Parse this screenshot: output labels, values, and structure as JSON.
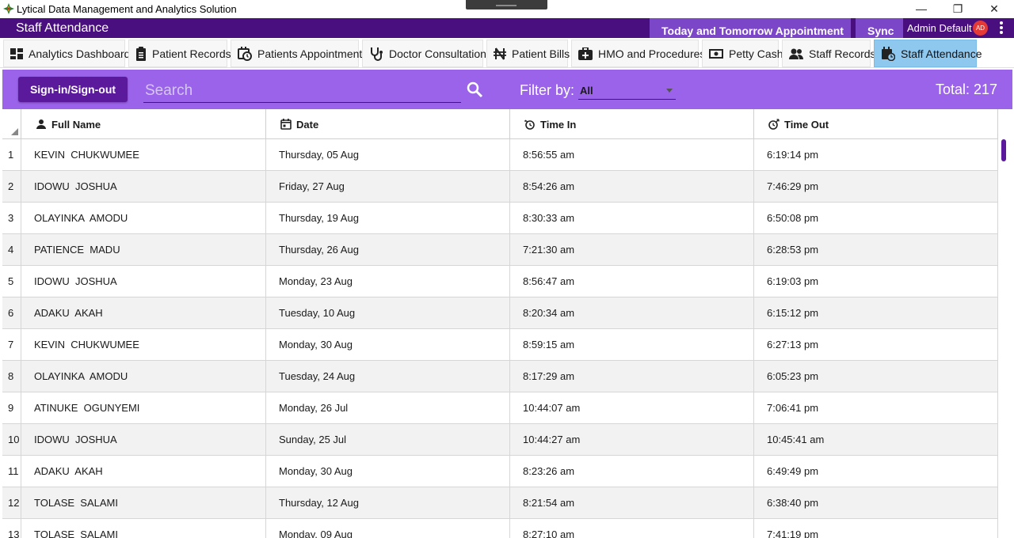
{
  "window": {
    "title": "Lytical Data Management and Analytics Solution",
    "min": "—",
    "max": "❐",
    "close": "✕"
  },
  "header": {
    "page_title": "Staff Attendance",
    "appointment_button": "Today and Tomorrow Appointment",
    "sync_button": "Sync",
    "user_name": "Admin Default",
    "avatar_initials": "AD"
  },
  "tabs": [
    {
      "label": "Analytics Dashboard",
      "icon": "dashboard-icon"
    },
    {
      "label": "Patient Records",
      "icon": "clipboard-icon"
    },
    {
      "label": "Patients Appointment",
      "icon": "calendar-clock-icon"
    },
    {
      "label": "Doctor Consultation",
      "icon": "stethoscope-icon"
    },
    {
      "label": "Patient Bills",
      "icon": "naira-icon"
    },
    {
      "label": "HMO and Procedures",
      "icon": "medical-bag-icon"
    },
    {
      "label": "Petty Cash",
      "icon": "cash-icon"
    },
    {
      "label": "Staff Records",
      "icon": "people-icon"
    },
    {
      "label": "Staff Attendance",
      "icon": "calendar-check-icon",
      "active": true
    }
  ],
  "toolbar": {
    "signin_button": "Sign-in/Sign-out",
    "search_placeholder": "Search",
    "filter_label": "Filter by:",
    "filter_value": "All",
    "total": "Total: 217"
  },
  "columns": [
    "Full Name",
    "Date",
    "Time In",
    "Time Out"
  ],
  "rows": [
    {
      "n": "1",
      "name": "KEVIN  CHUKWUMEE",
      "date": "Thursday, 05 Aug",
      "in": "8:56:55 am",
      "out": "6:19:14 pm"
    },
    {
      "n": "2",
      "name": "IDOWU  JOSHUA",
      "date": "Friday, 27 Aug",
      "in": "8:54:26 am",
      "out": "7:46:29 pm"
    },
    {
      "n": "3",
      "name": "OLAYINKA  AMODU",
      "date": "Thursday, 19 Aug",
      "in": "8:30:33 am",
      "out": "6:50:08 pm"
    },
    {
      "n": "4",
      "name": "PATIENCE  MADU",
      "date": "Thursday, 26 Aug",
      "in": "7:21:30 am",
      "out": "6:28:53 pm"
    },
    {
      "n": "5",
      "name": "IDOWU  JOSHUA",
      "date": "Monday, 23 Aug",
      "in": "8:56:47 am",
      "out": "6:19:03 pm"
    },
    {
      "n": "6",
      "name": "ADAKU  AKAH",
      "date": "Tuesday, 10 Aug",
      "in": "8:20:34 am",
      "out": "6:15:12 pm"
    },
    {
      "n": "7",
      "name": "KEVIN  CHUKWUMEE",
      "date": "Monday, 30 Aug",
      "in": "8:59:15 am",
      "out": "6:27:13 pm"
    },
    {
      "n": "8",
      "name": "OLAYINKA  AMODU",
      "date": "Tuesday, 24 Aug",
      "in": "8:17:29 am",
      "out": "6:05:23 pm"
    },
    {
      "n": "9",
      "name": "ATINUKE  OGUNYEMI",
      "date": "Monday, 26 Jul",
      "in": "10:44:07 am",
      "out": "7:06:41 pm"
    },
    {
      "n": "10",
      "name": "IDOWU  JOSHUA",
      "date": "Sunday, 25 Jul",
      "in": "10:44:27 am",
      "out": "10:45:41 am"
    },
    {
      "n": "11",
      "name": "ADAKU  AKAH",
      "date": "Monday, 30 Aug",
      "in": "8:23:26 am",
      "out": "6:49:49 pm"
    },
    {
      "n": "12",
      "name": "TOLASE  SALAMI",
      "date": "Thursday, 12 Aug",
      "in": "8:21:54 am",
      "out": "6:38:40 pm"
    },
    {
      "n": "13",
      "name": "TOLASE  SALAMI",
      "date": "Monday, 09 Aug",
      "in": "8:27:10 am",
      "out": "7:41:19 pm"
    }
  ],
  "colors": {
    "header_purple": "#4a0f7e",
    "toolbar_purple": "#9a63ea",
    "button_purple": "#5b1a9c",
    "active_tab": "#8fc8ee",
    "avatar_red": "#e53935"
  }
}
